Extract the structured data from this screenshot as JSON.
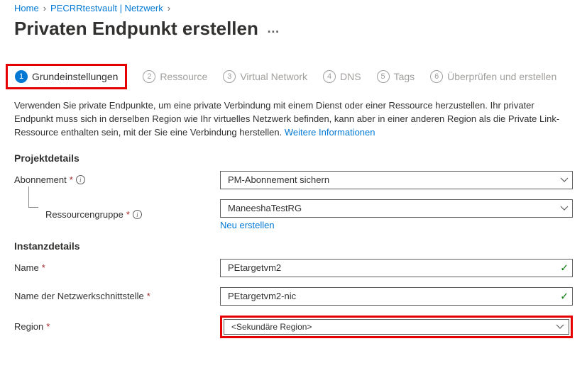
{
  "breadcrumb": {
    "home": "Home",
    "vault": "PECRRtestvault | Netzwerk"
  },
  "page": {
    "title": "Privaten Endpunkt erstellen",
    "more": "…"
  },
  "steps": {
    "s1": "Grundeinstellungen",
    "s2": "Ressource",
    "s3": "Virtual Network",
    "s4": "DNS",
    "s5": "Tags",
    "s6": "Überprüfen und erstellen"
  },
  "description": {
    "text": "Verwenden Sie private Endpunkte, um eine private Verbindung mit einem Dienst oder einer Ressource herzustellen. Ihr privater Endpunkt muss sich in derselben Region wie Ihr virtuelles Netzwerk befinden, kann aber in einer anderen Region als die Private Link-Ressource enthalten sein, mit der Sie eine Verbindung herstellen. ",
    "link": "Weitere Informationen"
  },
  "sections": {
    "project": "Projektdetails",
    "instance": "Instanzdetails"
  },
  "form": {
    "subscription": {
      "label": "Abonnement",
      "value": "PM-Abonnement sichern"
    },
    "resourceGroup": {
      "label": "Ressourcengruppe",
      "value": "ManeeshaTestRG",
      "newLink": "Neu erstellen"
    },
    "name": {
      "label": "Name",
      "value": "PEtargetvm2"
    },
    "nicName": {
      "label": "Name der Netzwerkschnittstelle",
      "value": "PEtargetvm2-nic"
    },
    "region": {
      "label": "Region",
      "value": "<Sekundäre Region>"
    }
  }
}
